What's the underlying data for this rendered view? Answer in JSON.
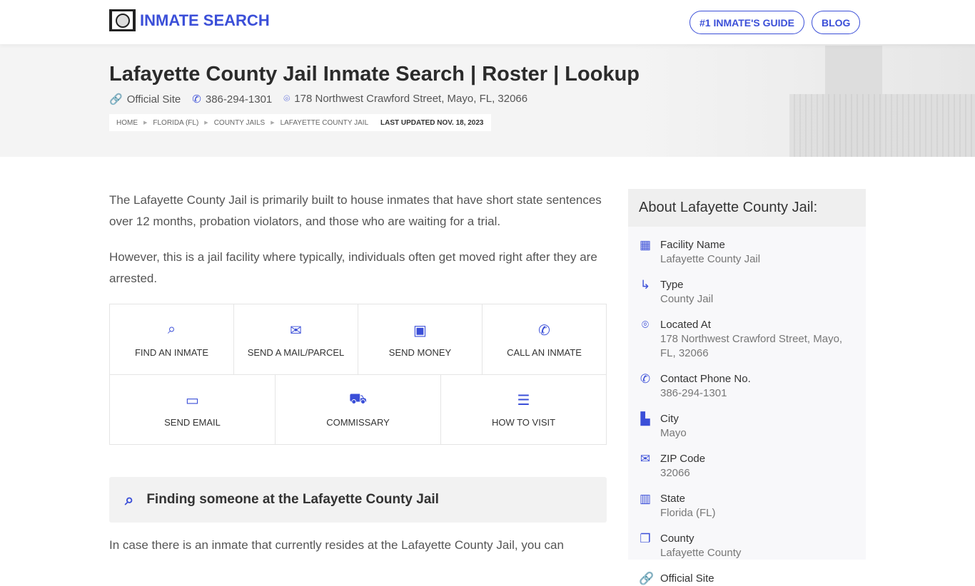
{
  "nav": {
    "logo": "INMATE SEARCH",
    "guide": "#1 INMATE'S GUIDE",
    "blog": "BLOG"
  },
  "hero": {
    "title": "Lafayette County Jail Inmate Search | Roster | Lookup",
    "official": "Official Site",
    "phone": "386-294-1301",
    "address": "178 Northwest Crawford Street, Mayo, FL, 32066",
    "crumbs": [
      "HOME",
      "FLORIDA (FL)",
      "COUNTY JAILS",
      "LAFAYETTE COUNTY JAIL"
    ],
    "updated": "LAST UPDATED NOV. 18, 2023"
  },
  "main": {
    "p1": "The Lafayette County Jail is primarily built to house inmates that have short state sentences over 12 months, probation violators, and those who are waiting for a trial.",
    "p2": "However, this is a jail facility where typically, individuals often get moved right after they are arrested.",
    "actions": [
      "FIND AN INMATE",
      "SEND A MAIL/PARCEL",
      "SEND MONEY",
      "CALL AN INMATE",
      "SEND EMAIL",
      "COMMISSARY",
      "HOW TO VISIT"
    ],
    "find_heading": "Finding someone at the Lafayette County Jail",
    "p3": "In case there is an inmate that currently resides at the Lafayette County Jail, you can"
  },
  "sidebar": {
    "title": "About Lafayette County Jail:",
    "items": [
      {
        "label": "Facility Name",
        "value": "Lafayette County Jail"
      },
      {
        "label": "Type",
        "value": "County Jail"
      },
      {
        "label": "Located At",
        "value": "178 Northwest Crawford Street, Mayo, FL, 32066"
      },
      {
        "label": "Contact Phone No.",
        "value": "386-294-1301"
      },
      {
        "label": "City",
        "value": "Mayo"
      },
      {
        "label": "ZIP Code",
        "value": "32066"
      },
      {
        "label": "State",
        "value": "Florida (FL)"
      },
      {
        "label": "County",
        "value": "Lafayette County"
      },
      {
        "label": "Official Site",
        "value": ""
      }
    ]
  },
  "colors": {
    "accent": "#3b4fd8"
  }
}
